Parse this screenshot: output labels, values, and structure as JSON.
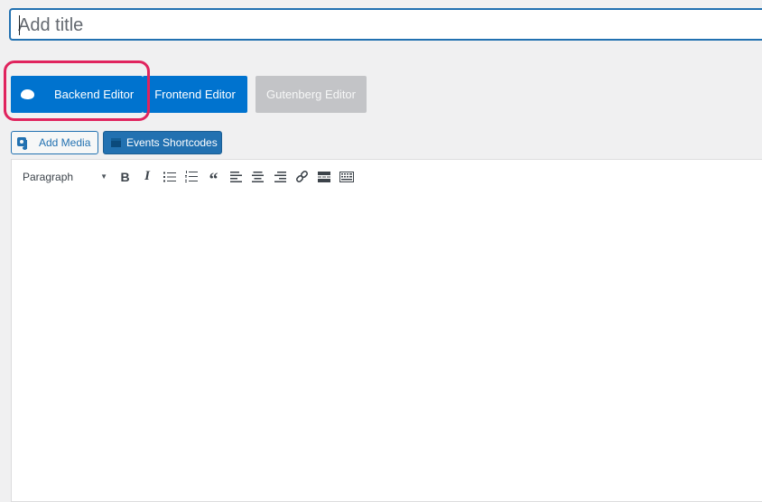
{
  "title": {
    "placeholder": "Add title",
    "value": ""
  },
  "editor_modes": {
    "backend_label": "Backend Editor",
    "frontend_label": "Frontend Editor",
    "gutenberg_label": "Gutenberg Editor"
  },
  "media_buttons": {
    "add_media_label": "Add Media",
    "events_shortcodes_label": "Events Shortcodes"
  },
  "toolbar": {
    "format_value": "Paragraph",
    "buttons": [
      {
        "name": "bold",
        "icon": "bold-icon",
        "glyph": "B"
      },
      {
        "name": "italic",
        "icon": "italic-icon",
        "glyph": "I"
      },
      {
        "name": "bulleted-list",
        "icon": "bulleted-list-icon"
      },
      {
        "name": "numbered-list",
        "icon": "numbered-list-icon"
      },
      {
        "name": "blockquote",
        "icon": "blockquote-icon",
        "glyph": "“"
      },
      {
        "name": "align-left",
        "icon": "align-left-icon"
      },
      {
        "name": "align-center",
        "icon": "align-center-icon"
      },
      {
        "name": "align-right",
        "icon": "align-right-icon"
      },
      {
        "name": "insert-link",
        "icon": "link-icon"
      },
      {
        "name": "read-more",
        "icon": "read-more-icon"
      },
      {
        "name": "toolbar-toggle",
        "icon": "keyboard-icon"
      }
    ]
  },
  "colors": {
    "primary_button": "#0073cf",
    "disabled_button": "#c3c4c7",
    "wp_blue": "#2271b1",
    "highlight_ring": "#e0245e",
    "background": "#f0f0f1"
  }
}
